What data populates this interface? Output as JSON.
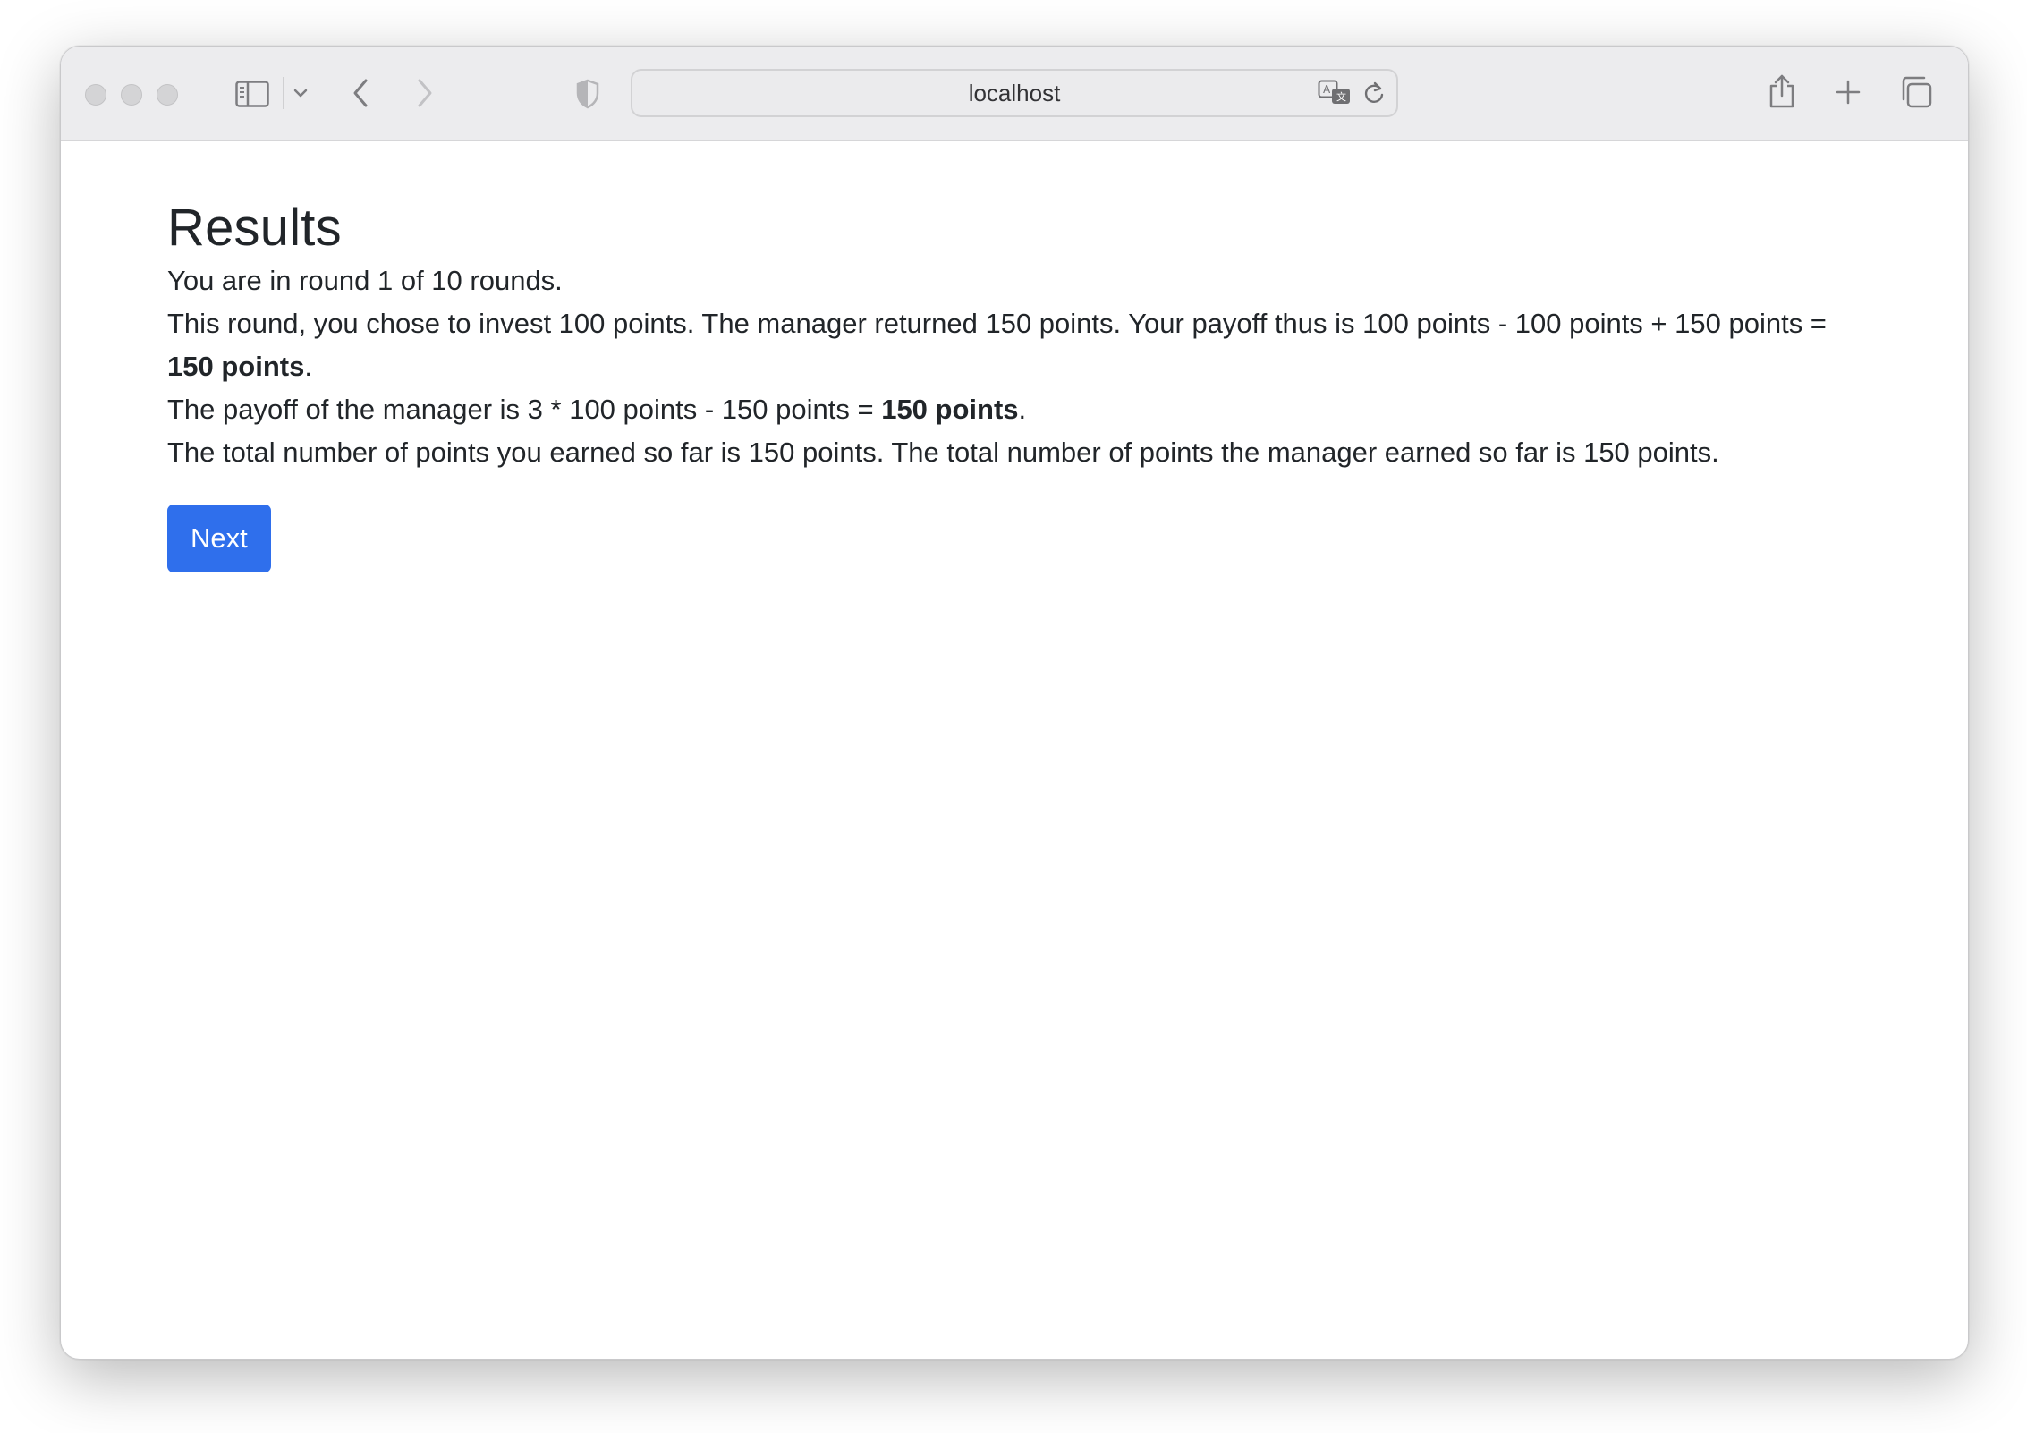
{
  "browser": {
    "url": "localhost",
    "icons": {
      "close": "traffic-light-close",
      "minimize": "traffic-light-minimize",
      "zoom": "traffic-light-zoom",
      "sidebar": "sidebar-icon",
      "sidebar_menu": "chevron-down-icon",
      "back": "chevron-left-icon",
      "forward": "chevron-right-icon",
      "privacy": "shield-icon",
      "translate": "translate-icon",
      "reload": "reload-icon",
      "share": "share-icon",
      "new_tab": "plus-icon",
      "tab_overview": "tabs-icon"
    }
  },
  "page": {
    "title": "Results",
    "round_text": "You are in round 1 of 10 rounds.",
    "investment_text": "This round, you chose to invest 100 points. The manager returned 150 points. Your payoff thus is 100 points - 100 points + 150 points = ",
    "investment_payoff": "150 points",
    "investment_suffix": ".",
    "manager_text": "The payoff of the manager is 3 * 100 points - 150 points = ",
    "manager_payoff": "150 points",
    "manager_suffix": ".",
    "total_text": "The total number of points you earned so far is 150 points. The total number of points the manager earned so far is 150 points.",
    "next_label": "Next"
  },
  "colors": {
    "primary_button": "#2f6fec",
    "text": "#212529",
    "toolbar": "#ececee"
  }
}
